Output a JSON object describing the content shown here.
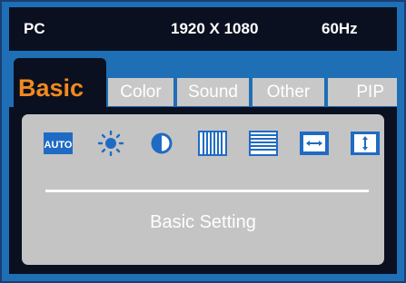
{
  "header": {
    "source": "PC",
    "resolution": "1920 X 1080",
    "refresh_rate": "60Hz"
  },
  "tabs": {
    "active": "Basic",
    "items": [
      "Color",
      "Sound",
      "Other",
      "PIP"
    ]
  },
  "panel": {
    "icons": [
      {
        "name": "auto-icon",
        "label": "AUTO"
      },
      {
        "name": "brightness-icon"
      },
      {
        "name": "contrast-icon"
      },
      {
        "name": "vertical-lines-icon"
      },
      {
        "name": "horizontal-lines-icon"
      },
      {
        "name": "horizontal-position-icon"
      },
      {
        "name": "vertical-position-icon"
      }
    ],
    "label": "Basic Setting"
  },
  "colors": {
    "background": "#1e6fb5",
    "header": "#0b1020",
    "accent": "#f28a1e",
    "tab": "#c8c8c8",
    "panel": "#c4c4c4",
    "icon_blue": "#1f6bc4"
  }
}
